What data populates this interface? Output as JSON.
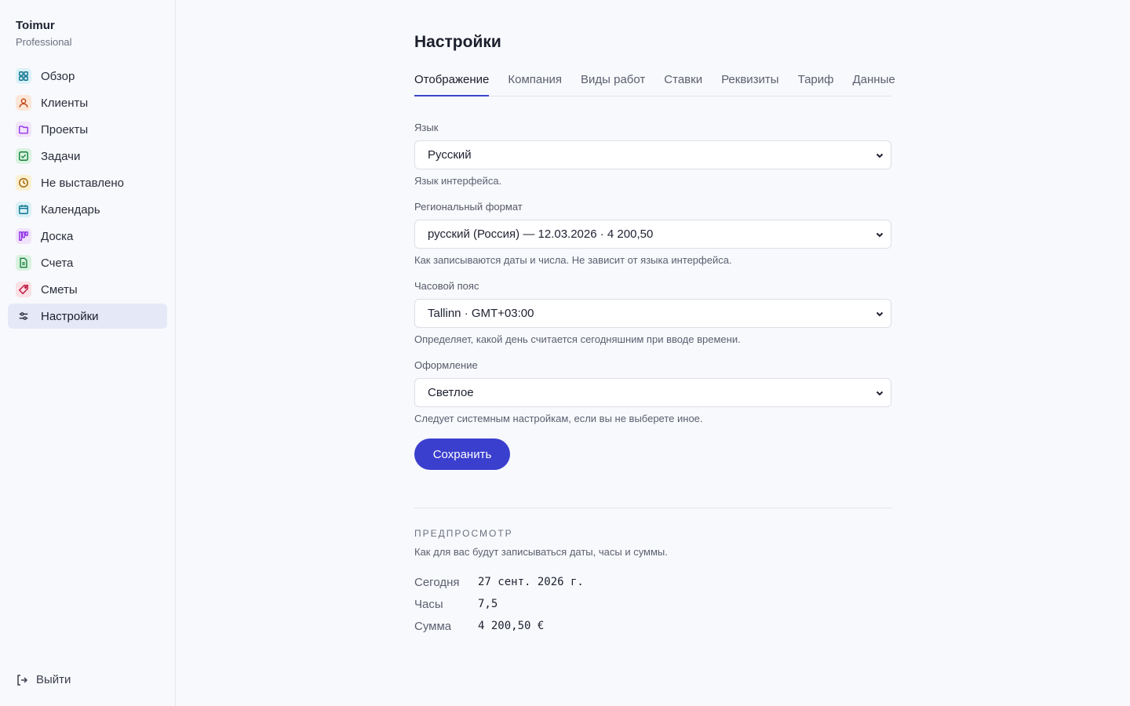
{
  "brand": {
    "name": "Toimur",
    "plan": "Professional"
  },
  "sidebar": {
    "items": [
      {
        "label": "Обзор",
        "icon": "grid-icon",
        "color": "#0e7490",
        "bg": "#dbf1f7"
      },
      {
        "label": "Клиенты",
        "icon": "user-icon",
        "color": "#c2410c",
        "bg": "#fde6d8"
      },
      {
        "label": "Проекты",
        "icon": "folder-icon",
        "color": "#9333ea",
        "bg": "#f1e4fb"
      },
      {
        "label": "Задачи",
        "icon": "check-square-icon",
        "color": "#15803d",
        "bg": "#d9f2e0"
      },
      {
        "label": "Не выставлено",
        "icon": "clock-icon",
        "color": "#a16207",
        "bg": "#fbefcf"
      },
      {
        "label": "Календарь",
        "icon": "calendar-icon",
        "color": "#0e7490",
        "bg": "#d9f0f5"
      },
      {
        "label": "Доска",
        "icon": "kanban-icon",
        "color": "#9333ea",
        "bg": "#efe2fa"
      },
      {
        "label": "Счета",
        "icon": "invoice-icon",
        "color": "#15803d",
        "bg": "#d9f2e0"
      },
      {
        "label": "Сметы",
        "icon": "tag-icon",
        "color": "#be123c",
        "bg": "#fbe0e4"
      },
      {
        "label": "Настройки",
        "icon": "sliders-icon",
        "color": "#2a2e3b",
        "bg": "transparent",
        "active": true
      }
    ],
    "logout": "Выйти"
  },
  "page": {
    "title": "Настройки",
    "tabs": [
      "Отображение",
      "Компания",
      "Виды работ",
      "Ставки",
      "Реквизиты",
      "Тариф",
      "Данные"
    ],
    "active_tab": "Отображение"
  },
  "form": {
    "language": {
      "label": "Язык",
      "value": "Русский",
      "hint": "Язык интерфейса."
    },
    "region": {
      "label": "Региональный формат",
      "value": "русский (Россия) — 12.03.2026 · 4 200,50",
      "hint": "Как записываются даты и числа. Не зависит от языка интерфейса."
    },
    "timezone": {
      "label": "Часовой пояс",
      "value": "Tallinn · GMT+03:00",
      "hint": "Определяет, какой день считается сегодняшним при вводе времени."
    },
    "theme": {
      "label": "Оформление",
      "value": "Светлое",
      "hint": "Следует системным настройкам, если вы не выберете иное."
    },
    "save_label": "Сохранить"
  },
  "preview": {
    "title": "Предпросмотр",
    "subtitle": "Как для вас будут записываться даты, часы и суммы.",
    "rows": [
      {
        "key": "Сегодня",
        "value": "27 сент. 2026 г."
      },
      {
        "key": "Часы",
        "value": "7,5"
      },
      {
        "key": "Сумма",
        "value": "4 200,50 €"
      }
    ]
  },
  "colors": {
    "accent": "#3a3fce",
    "active_nav_bg": "#e5e9f7"
  }
}
